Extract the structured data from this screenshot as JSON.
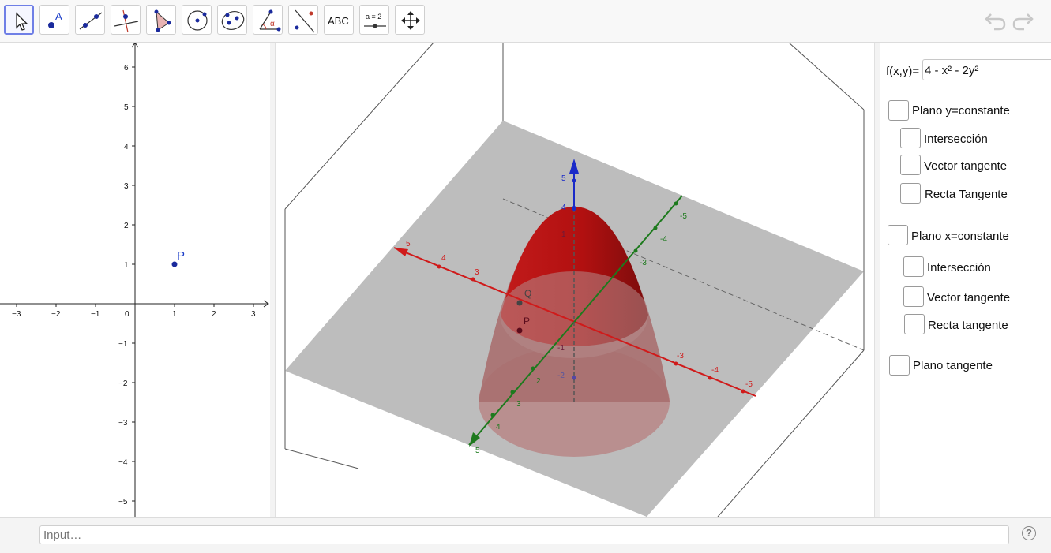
{
  "toolbar": {
    "tools": [
      {
        "name": "move-tool",
        "icon": "cursor-arrow-icon"
      },
      {
        "name": "point-tool",
        "icon": "point-label-icon",
        "text": "A"
      },
      {
        "name": "line-tool",
        "icon": "line-through-points-icon"
      },
      {
        "name": "perpendicular-tool",
        "icon": "perpendicular-line-icon"
      },
      {
        "name": "polygon-tool",
        "icon": "polygon-icon"
      },
      {
        "name": "circle-tool",
        "icon": "circle-center-point-icon"
      },
      {
        "name": "conic-tool",
        "icon": "ellipse-icon"
      },
      {
        "name": "angle-tool",
        "icon": "angle-icon",
        "text": "α"
      },
      {
        "name": "reflect-tool",
        "icon": "reflect-point-icon"
      },
      {
        "name": "text-tool",
        "icon": "text-icon",
        "text": "ABC"
      },
      {
        "name": "slider-tool",
        "icon": "slider-icon",
        "text": "a = 2"
      },
      {
        "name": "move-view-tool",
        "icon": "move-arrows-icon"
      }
    ],
    "undo_icon": "undo-icon",
    "redo_icon": "redo-icon"
  },
  "graphics2d": {
    "x_ticks": [
      "−3",
      "−2",
      "−1",
      "0",
      "1",
      "2",
      "3"
    ],
    "y_ticks": [
      "6",
      "5",
      "4",
      "3",
      "2",
      "1",
      "−1",
      "−2",
      "−3",
      "−4",
      "−5"
    ],
    "point_label": "P"
  },
  "graphics3d": {
    "x_axis_labels": [
      "5",
      "4",
      "3",
      "-3",
      "-4",
      "-5"
    ],
    "y_axis_labels": [
      "-5",
      "-4",
      "-3",
      "2",
      "3",
      "4",
      "5"
    ],
    "z_axis_labels": [
      "5",
      "4",
      "1",
      "-1",
      "-2"
    ],
    "point_labels": [
      "Q",
      "P"
    ]
  },
  "panel": {
    "function_label": "f(x,y)=",
    "function_value": "4 - x² - 2y²",
    "checkboxes": [
      {
        "label": "Plano y=constante"
      },
      {
        "label": "Intersección"
      },
      {
        "label": "Vector tangente"
      },
      {
        "label": "Recta Tangente"
      },
      {
        "label": "Plano x=constante"
      },
      {
        "label": "Intersección"
      },
      {
        "label": "Vector tangente"
      },
      {
        "label": "Recta tangente"
      },
      {
        "label": "Plano tangente"
      }
    ]
  },
  "input_bar": {
    "placeholder": "Input…"
  },
  "help_icon": {
    "text": "?"
  }
}
